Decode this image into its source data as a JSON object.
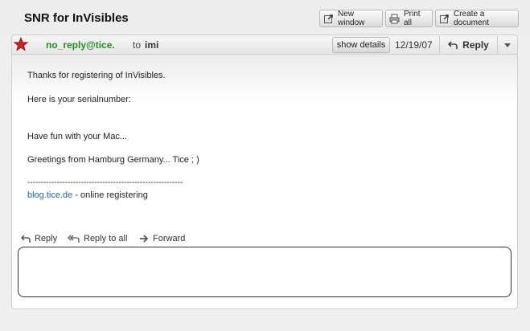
{
  "subject": "SNR for InVisibles",
  "toolbar": {
    "new_window": "New window",
    "print_all": "Print all",
    "create_document": "Create a document"
  },
  "message": {
    "from": "no_reply@tice.",
    "to_label": "to",
    "to": "imi",
    "show_details": "show details",
    "date": "12/19/07",
    "reply": "Reply"
  },
  "body": {
    "line1": "Thanks for registering of InVisibles.",
    "line2": "Here is your serialnumber:",
    "line3": "Have fun with your Mac...",
    "line4": "Greetings from Hamburg Germany... Tice ; )",
    "separator": "----------------------------------------------------------",
    "link": "blog.tice.de",
    "link_suffix": " - online registering"
  },
  "actions": {
    "reply": "Reply",
    "reply_all": "Reply to all",
    "forward": "Forward"
  },
  "colors": {
    "sender": "#2a8a2a",
    "link": "#2266aa",
    "star": "#cc2222"
  }
}
